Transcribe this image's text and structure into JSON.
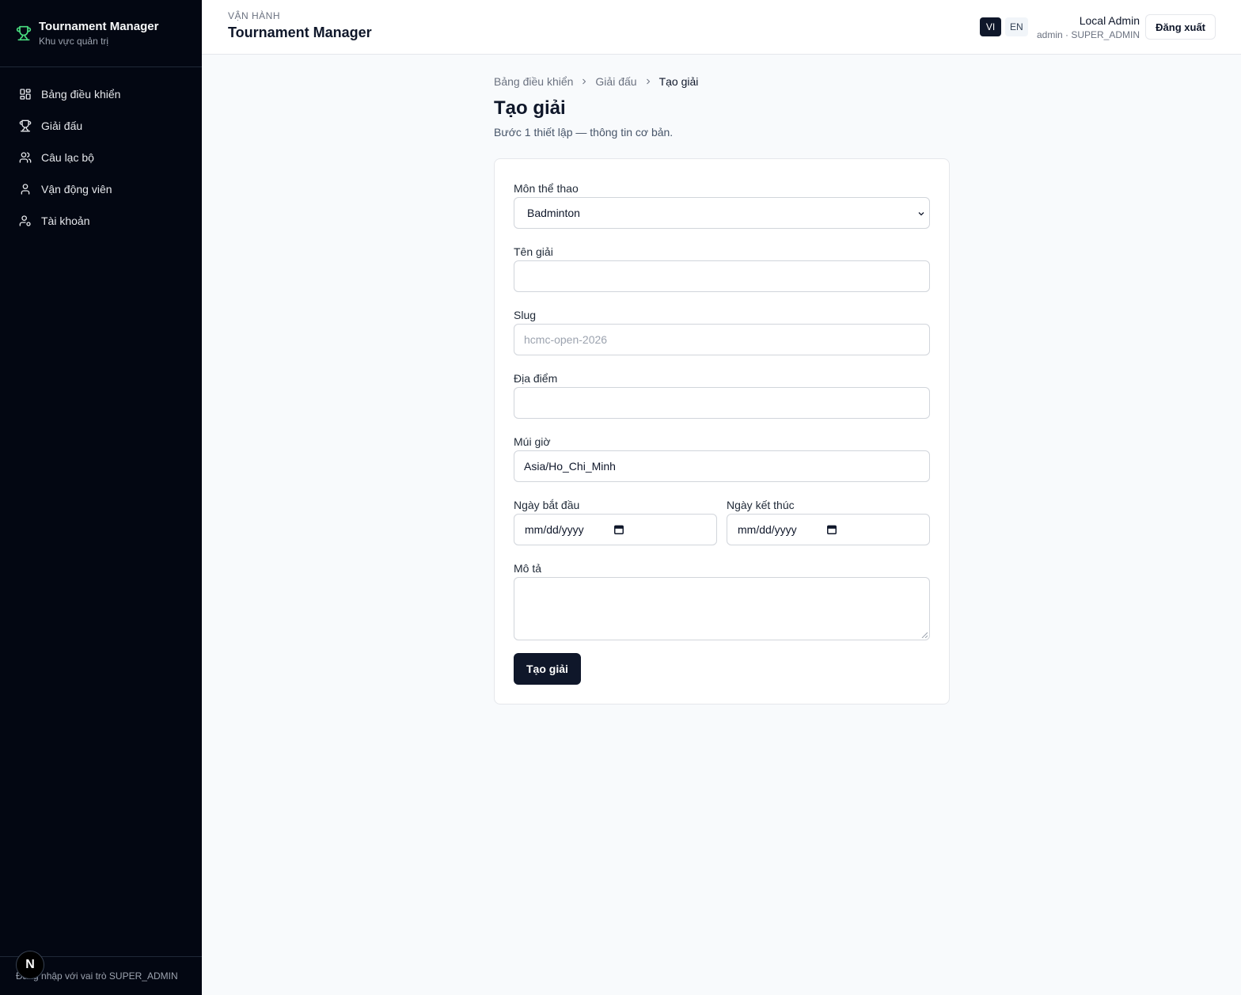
{
  "sidebar": {
    "brand_title": "Tournament Manager",
    "brand_subtitle": "Khu vực quản trị",
    "items": [
      {
        "label": "Bảng điều khiển",
        "icon": "dashboard-icon"
      },
      {
        "label": "Giải đấu",
        "icon": "trophy-icon"
      },
      {
        "label": "Câu lạc bộ",
        "icon": "users-icon"
      },
      {
        "label": "Vận động viên",
        "icon": "user-icon"
      },
      {
        "label": "Tài khoản",
        "icon": "user-cog-icon"
      }
    ],
    "footer": "Đăng nhập với vai trò SUPER_ADMIN",
    "n_badge": "N"
  },
  "header": {
    "overline": "VẬN HÀNH",
    "title": "Tournament Manager",
    "lang_vi": "VI",
    "lang_en": "EN",
    "user_name": "Local Admin",
    "user_role": "admin · SUPER_ADMIN",
    "logout": "Đăng xuất"
  },
  "breadcrumb": [
    "Bảng điều khiển",
    "Giải đấu",
    "Tạo giải"
  ],
  "page": {
    "title": "Tạo giải",
    "subtitle": "Bước 1 thiết lập — thông tin cơ bản."
  },
  "form": {
    "sport_label": "Môn thể thao",
    "sport_value": "Badminton",
    "name_label": "Tên giải",
    "name_value": "",
    "slug_label": "Slug",
    "slug_placeholder": "hcmc-open-2026",
    "location_label": "Địa điểm",
    "location_value": "",
    "timezone_label": "Múi giờ",
    "timezone_value": "Asia/Ho_Chi_Minh",
    "start_label": "Ngày bắt đầu",
    "start_placeholder": "mm/dd/yyyy",
    "end_label": "Ngày kết thúc",
    "end_placeholder": "mm/dd/yyyy",
    "desc_label": "Mô tả",
    "desc_value": "",
    "submit": "Tạo giải"
  },
  "colors": {
    "sidebar_bg": "#030712",
    "accent": "#0f172a",
    "brand_icon": "#4ade80"
  }
}
